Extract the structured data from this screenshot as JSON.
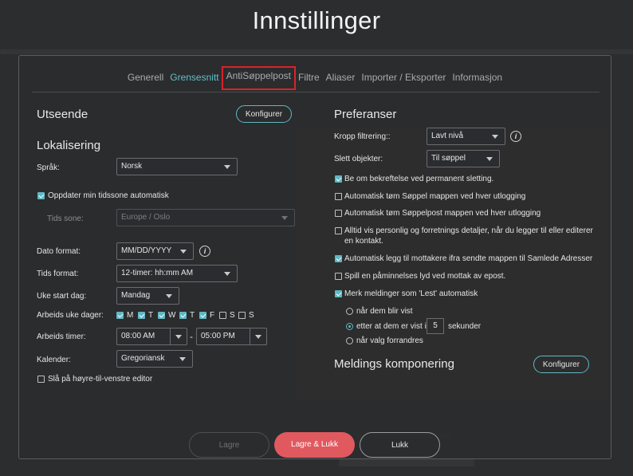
{
  "title": "Innstillinger",
  "tabs": [
    {
      "label": "Generell"
    },
    {
      "label": "Grensesnitt"
    },
    {
      "label": "AntiSøppelpost"
    },
    {
      "label": "Filtre"
    },
    {
      "label": "Aliaser"
    },
    {
      "label": "Importer / Eksporter"
    },
    {
      "label": "Informasjon"
    }
  ],
  "active_tab": "Grensesnitt",
  "highlighted_tab": "AntiSøppelpost",
  "left": {
    "appearance_heading": "Utseende",
    "configure_label": "Konfigurer",
    "localization_heading": "Lokalisering",
    "language_label": "Språk:",
    "language_value": "Norsk",
    "auto_timezone_label": "Oppdater min tidssone automatisk",
    "auto_timezone_checked": true,
    "timezone_label": "Tids sone:",
    "timezone_value": "Europe / Oslo",
    "date_format_label": "Dato format:",
    "date_format_value": "MM/DD/YYYY",
    "time_format_label": "Tids format:",
    "time_format_value": "12-timer: hh:mm AM",
    "week_start_label": "Uke start dag:",
    "week_start_value": "Mandag",
    "workdays_label": "Arbeids uke dager:",
    "workdays": [
      {
        "label": "M",
        "checked": true
      },
      {
        "label": "T",
        "checked": true
      },
      {
        "label": "W",
        "checked": true
      },
      {
        "label": "T",
        "checked": true
      },
      {
        "label": "F",
        "checked": true
      },
      {
        "label": "S",
        "checked": false
      },
      {
        "label": "S",
        "checked": false
      }
    ],
    "work_hours_label": "Arbeids timer:",
    "work_start": "08:00 AM",
    "work_sep": "-",
    "work_end": "05:00 PM",
    "calendar_label": "Kalender:",
    "calendar_value": "Gregoriansk",
    "rtl_label": "Slå på høyre-til-venstre editor",
    "rtl_checked": false
  },
  "right": {
    "preferences_heading": "Preferanser",
    "body_filter_label": "Kropp filtrering::",
    "body_filter_value": "Lavt nivå",
    "delete_objects_label": "Slett objekter:",
    "delete_objects_value": "Til søppel",
    "options": [
      {
        "label": "Be om bekreftelse ved permanent sletting.",
        "checked": true
      },
      {
        "label": "Automatisk tøm Søppel mappen ved hver utlogging",
        "checked": false
      },
      {
        "label": "Automatisk tøm Søppelpost mappen ved hver utlogging",
        "checked": false
      },
      {
        "label": "Alltid vis personlig og forretnings detaljer, når du legger til eller editerer en kontakt.",
        "checked": false
      },
      {
        "label": "Automatisk legg til mottakere ifra sendte mappen til Samlede Adresser",
        "checked": true
      },
      {
        "label": "Spill en påminnelses lyd ved mottak av epost.",
        "checked": false
      },
      {
        "label": "Merk meldinger som 'Lest' automatisk",
        "checked": true
      }
    ],
    "read_opts": {
      "opt1": "når dem blir vist",
      "opt2_prefix": "etter at dem er vist i",
      "opt2_value": "5",
      "opt2_suffix": "sekunder",
      "opt3": "når valg forrandres",
      "selected": 2
    },
    "compose_heading": "Meldings komponering",
    "compose_configure_label": "Konfigurer"
  },
  "footer": {
    "save_label": "Lagre",
    "save_close_label": "Lagre & Lukk",
    "close_label": "Lukk"
  },
  "colors": {
    "accent": "#5fb8c3",
    "primary_button": "#e0595f",
    "highlight_box": "#d8232a"
  }
}
